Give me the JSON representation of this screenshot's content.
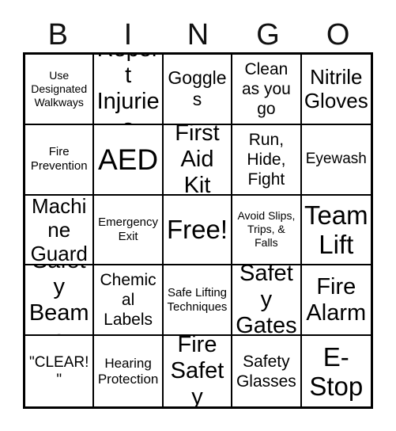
{
  "card": {
    "title": "BINGO",
    "header_letters": [
      "B",
      "I",
      "N",
      "G",
      "O"
    ],
    "free_space_index": 12,
    "colors": {
      "background": "#ffffff",
      "border": "#000000",
      "text": "#000000",
      "header_text": "#111111"
    },
    "cells": [
      {
        "text": "Use Designated Walkways",
        "size": "sz-xs"
      },
      {
        "text": "Report Injuries",
        "size": "sz-xxl"
      },
      {
        "text": "Goggles",
        "size": "sz-l"
      },
      {
        "text": "Clean as you go",
        "size": "sz-ml"
      },
      {
        "text": "Nitrile Gloves",
        "size": "sz-xl"
      },
      {
        "text": "Fire Prevention",
        "size": "sz-s"
      },
      {
        "text": "AED",
        "size": "sz-mega"
      },
      {
        "text": "First Aid Kit",
        "size": "sz-xxl"
      },
      {
        "text": "Run, Hide, Fight",
        "size": "sz-ml"
      },
      {
        "text": "Eyewash",
        "size": "sz-m"
      },
      {
        "text": "Machine Guard",
        "size": "sz-xl"
      },
      {
        "text": "Emergency Exit",
        "size": "sz-s"
      },
      {
        "text": "Free!",
        "size": "sz-huge"
      },
      {
        "text": "Avoid Slips, Trips, & Falls",
        "size": "sz-xs"
      },
      {
        "text": "Team Lift",
        "size": "sz-huge"
      },
      {
        "text": "Safety Beams",
        "size": "sz-xxl"
      },
      {
        "text": "Chemical Labels",
        "size": "sz-ml"
      },
      {
        "text": "Safe Lifting Techniques",
        "size": "sz-s"
      },
      {
        "text": "Safety Gates",
        "size": "sz-xxl"
      },
      {
        "text": "Fire Alarm",
        "size": "sz-xxl"
      },
      {
        "text": "\"CLEAR!\"",
        "size": "sz-m"
      },
      {
        "text": "Hearing Protection",
        "size": "sz-sm"
      },
      {
        "text": "Fire Safety",
        "size": "sz-xxl"
      },
      {
        "text": "Safety Glasses",
        "size": "sz-ml"
      },
      {
        "text": "E-Stop",
        "size": "sz-huge"
      }
    ]
  }
}
